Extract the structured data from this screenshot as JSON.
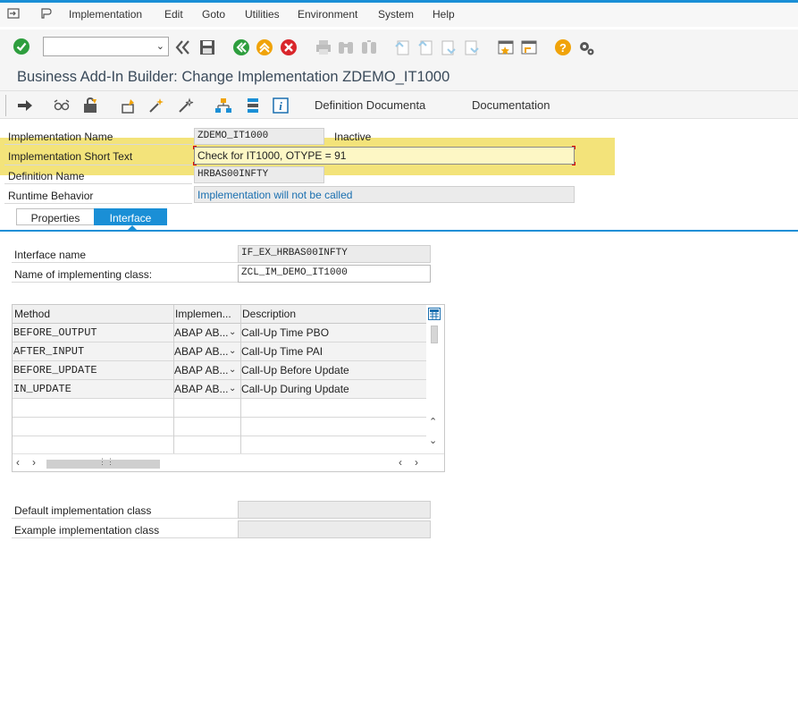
{
  "menu": {
    "items": [
      "Implementation",
      "Edit",
      "Goto",
      "Utilities",
      "Environment",
      "System",
      "Help"
    ]
  },
  "toolbar": {
    "command_value": ""
  },
  "title": "Business Add-In Builder: Change Implementation ZDEMO_IT1000",
  "app_toolbar": {
    "definition_doc": "Definition Documenta",
    "documentation": "Documentation"
  },
  "header": {
    "impl_name_label": "Implementation Name",
    "impl_name_value": "ZDEMO_IT1000",
    "status": "Inactive",
    "short_text_label": "Implementation Short Text",
    "short_text_value": "Check for IT1000, OTYPE = 91",
    "def_name_label": "Definition Name",
    "def_name_value": "HRBAS00INFTY",
    "runtime_label": "Runtime Behavior",
    "runtime_value": "Implementation will not be called"
  },
  "tabs": [
    {
      "label": "Properties",
      "active": false
    },
    {
      "label": "Interface",
      "active": true
    }
  ],
  "interface": {
    "name_label": "Interface name",
    "name_value": "IF_EX_HRBAS00INFTY",
    "class_label": "Name of implementing class:",
    "class_value": "ZCL_IM_DEMO_IT1000"
  },
  "methods_table": {
    "columns": [
      "Method",
      "Implemen...",
      "Description"
    ],
    "rows": [
      {
        "method": "BEFORE_OUTPUT",
        "impl": "ABAP AB...",
        "desc": "Call-Up Time PBO"
      },
      {
        "method": "AFTER_INPUT",
        "impl": "ABAP AB...",
        "desc": "Call-Up Time PAI"
      },
      {
        "method": "BEFORE_UPDATE",
        "impl": "ABAP AB...",
        "desc": "Call-Up Before Update"
      },
      {
        "method": "IN_UPDATE",
        "impl": "ABAP AB...",
        "desc": "Call-Up During Update"
      }
    ]
  },
  "footer": {
    "default_class_label": "Default implementation class",
    "default_class_value": "",
    "example_class_label": "Example implementation class",
    "example_class_value": ""
  },
  "colors": {
    "accent": "#1a8fd6",
    "highlight": "#f3e37a",
    "ok_green": "#2e9e3e",
    "cancel_red": "#d9262b",
    "help_orange": "#f0a30a"
  }
}
